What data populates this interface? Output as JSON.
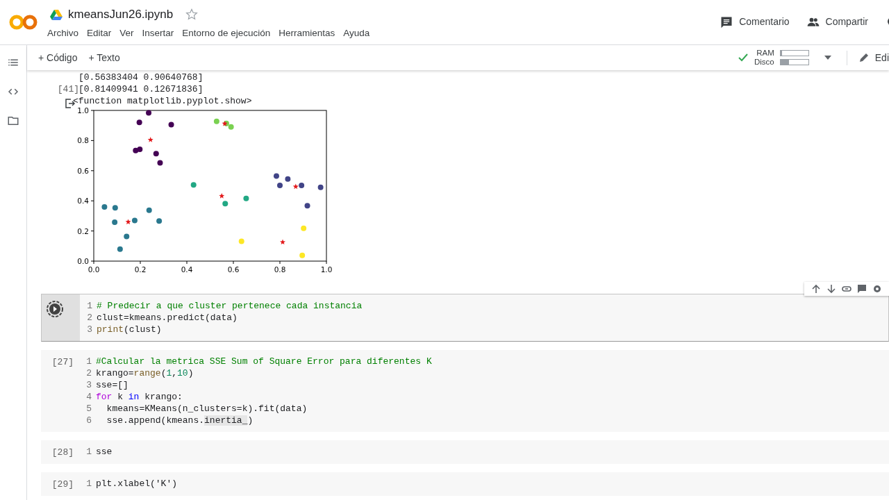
{
  "header": {
    "title": "kmeansJun26.ipynb",
    "starred": false,
    "menu": [
      "Archivo",
      "Editar",
      "Ver",
      "Insertar",
      "Entorno de ejecución",
      "Herramientas",
      "Ayuda"
    ],
    "actions": [
      {
        "kind": "comment",
        "label": "Comentario"
      },
      {
        "kind": "share",
        "label": "Compartir"
      }
    ]
  },
  "sidebar": {
    "items": [
      {
        "kind": "toc"
      },
      {
        "kind": "code"
      },
      {
        "kind": "files"
      }
    ]
  },
  "toolbar": {
    "add_buttons": [
      "+ Código",
      "+ Texto"
    ],
    "connected": true,
    "resources": [
      {
        "label": "RAM",
        "level": 0.05
      },
      {
        "label": "Disco",
        "level": 0.3
      }
    ],
    "edit_label": "Edi"
  },
  "output": {
    "exec_count": "[41]",
    "lines": [
      "[0.56383404 0.90640768]",
      "[0.81409941 0.12671836]",
      "<function matplotlib.pyplot.show>"
    ],
    "chart_data": {
      "type": "scatter",
      "xlim": [
        0,
        1
      ],
      "ylim": [
        0,
        1
      ],
      "xticks": [
        {
          "value": 0,
          "label": "0.0"
        },
        {
          "value": 0.2,
          "label": "0.2"
        },
        {
          "value": 0.4,
          "label": "0.4"
        },
        {
          "value": 0.6,
          "label": "0.6"
        },
        {
          "value": 0.8,
          "label": "0.8"
        },
        {
          "value": 1,
          "label": "1.0"
        }
      ],
      "yticks": [
        {
          "value": 0,
          "label": "0.0"
        },
        {
          "value": 0.2,
          "label": "0.2"
        },
        {
          "value": 0.4,
          "label": "0.4"
        },
        {
          "value": 0.6,
          "label": "0.6"
        },
        {
          "value": 0.8,
          "label": "0.8"
        },
        {
          "value": 1,
          "label": "1.0"
        }
      ],
      "series": [
        {
          "marker": "o",
          "color": "#440154",
          "x": [
            0.236,
            0.196,
            0.333,
            0.18,
            0.198,
            0.268,
            0.285
          ],
          "values": [
            0.984,
            0.92,
            0.906,
            0.734,
            0.742,
            0.713,
            0.652
          ]
        },
        {
          "marker": "o",
          "color": "#7ad151",
          "x": [
            0.528,
            0.57,
            0.59
          ],
          "values": [
            0.927,
            0.914,
            0.89
          ]
        },
        {
          "marker": "o",
          "color": "#414487",
          "x": [
            0.785,
            0.8,
            0.834,
            0.893,
            0.975,
            0.918
          ],
          "values": [
            0.565,
            0.502,
            0.545,
            0.502,
            0.49,
            0.368
          ]
        },
        {
          "marker": "o",
          "color": "#22a884",
          "x": [
            0.429,
            0.565,
            0.655
          ],
          "values": [
            0.506,
            0.381,
            0.416
          ]
        },
        {
          "marker": "o",
          "color": "#2a788e",
          "x": [
            0.046,
            0.092,
            0.09,
            0.176,
            0.238,
            0.281,
            0.141,
            0.113
          ],
          "values": [
            0.36,
            0.354,
            0.258,
            0.27,
            0.338,
            0.266,
            0.164,
            0.08
          ]
        },
        {
          "marker": "o",
          "color": "#fde725",
          "x": [
            0.635,
            0.902,
            0.896
          ],
          "values": [
            0.131,
            0.218,
            0.038
          ]
        },
        {
          "marker": "*",
          "color": "#e31a1c",
          "x": [
            0.244,
            0.563,
            0.55,
            0.868,
            0.148,
            0.812
          ],
          "values": [
            0.805,
            0.912,
            0.432,
            0.494,
            0.26,
            0.126
          ]
        }
      ]
    }
  },
  "cells": [
    {
      "focused": true,
      "lines": [
        {
          "number": "1",
          "tokens": [
            {
              "kind": "comment",
              "text": "# Predecir a que cluster pertenece cada instancia"
            }
          ]
        },
        {
          "number": "2",
          "tokens": [
            {
              "kind": "plain",
              "text": "clust=kmeans.predict(data)"
            }
          ]
        },
        {
          "number": "3",
          "tokens": [
            {
              "kind": "builtin",
              "text": "print"
            },
            {
              "kind": "plain",
              "text": "(clust)"
            }
          ]
        }
      ]
    },
    {
      "exec_count": "[27]",
      "focused": false,
      "lines": [
        {
          "number": "1",
          "tokens": [
            {
              "kind": "comment",
              "text": "#Calcular la metrica SSE Sum of Square Error para diferentes K"
            }
          ]
        },
        {
          "number": "2",
          "tokens": [
            {
              "kind": "plain",
              "text": "krango="
            },
            {
              "kind": "builtin",
              "text": "range"
            },
            {
              "kind": "plain",
              "text": "("
            },
            {
              "kind": "number",
              "text": "1"
            },
            {
              "kind": "plain",
              "text": ","
            },
            {
              "kind": "number",
              "text": "10"
            },
            {
              "kind": "plain",
              "text": ")"
            }
          ]
        },
        {
          "number": "3",
          "tokens": [
            {
              "kind": "plain",
              "text": "sse=[]"
            }
          ]
        },
        {
          "number": "4",
          "tokens": [
            {
              "kind": "keyword",
              "text": "for"
            },
            {
              "kind": "plain",
              "text": " k "
            },
            {
              "kind": "operator",
              "text": "in"
            },
            {
              "kind": "plain",
              "text": " krango:"
            }
          ]
        },
        {
          "number": "5",
          "tokens": [
            {
              "kind": "plain",
              "text": "  kmeans=KMeans(n_clusters=k).fit(data)"
            }
          ]
        },
        {
          "number": "6",
          "tokens": [
            {
              "kind": "plain",
              "text": "  sse.append(kmeans."
            },
            {
              "kind": "highlight",
              "text": "inertia_"
            },
            {
              "kind": "plain",
              "text": ")"
            }
          ]
        }
      ]
    },
    {
      "exec_count": "[28]",
      "focused": false,
      "lines": [
        {
          "number": "1",
          "tokens": [
            {
              "kind": "plain",
              "text": "sse"
            }
          ]
        }
      ]
    },
    {
      "exec_count": "[29]",
      "focused": false,
      "lines": [
        {
          "number": "1",
          "tokens": [
            {
              "kind": "plain",
              "text": "plt.xlabel('K')"
            }
          ]
        }
      ]
    }
  ]
}
